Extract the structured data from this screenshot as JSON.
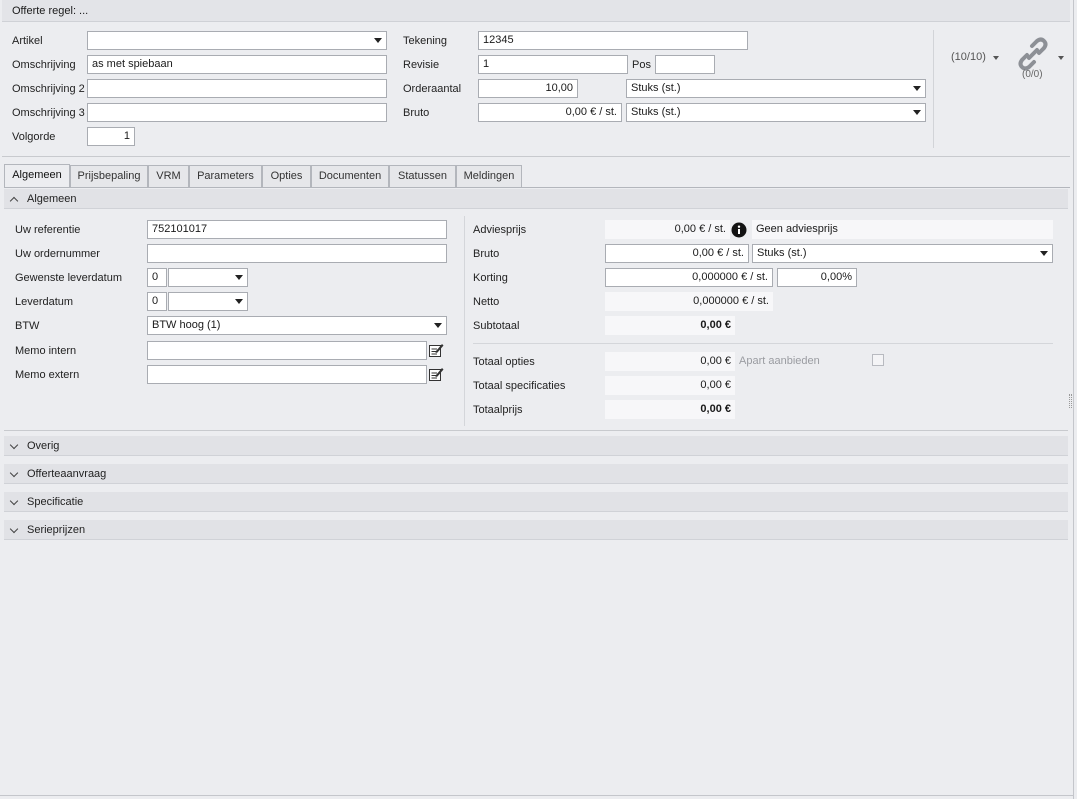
{
  "header": {
    "title": "Offerte regel: ..."
  },
  "top": {
    "artikel_label": "Artikel",
    "artikel_value": "",
    "omschrijving_label": "Omschrijving",
    "omschrijving_value": "as met spiebaan",
    "omschrijving2_label": "Omschrijving 2",
    "omschrijving2_value": "",
    "omschrijving3_label": "Omschrijving 3",
    "omschrijving3_value": "",
    "volgorde_label": "Volgorde",
    "volgorde_value": "1",
    "tekening_label": "Tekening",
    "tekening_value": "12345",
    "revisie_label": "Revisie",
    "revisie_value": "1",
    "pos_label": "Pos",
    "pos_value": "",
    "orderaantal_label": "Orderaantal",
    "orderaantal_value": "10,00",
    "orderaantal_unit": "Stuks (st.)",
    "bruto_label": "Bruto",
    "bruto_value": "0,00 € / st.",
    "bruto_unit": "Stuks (st.)",
    "counter": "(10/10)",
    "link_count": "(0/0)"
  },
  "tabs": [
    {
      "label": "Algemeen"
    },
    {
      "label": "Prijsbepaling"
    },
    {
      "label": "VRM"
    },
    {
      "label": "Parameters"
    },
    {
      "label": "Opties"
    },
    {
      "label": "Documenten"
    },
    {
      "label": "Statussen"
    },
    {
      "label": "Meldingen"
    }
  ],
  "algemeen": {
    "section_title": "Algemeen",
    "uw_referentie_label": "Uw referentie",
    "uw_referentie_value": "752101017",
    "uw_ordernummer_label": "Uw ordernummer",
    "uw_ordernummer_value": "",
    "gewenste_leverdatum_label": "Gewenste leverdatum",
    "gewenste_leverdatum_num": "0",
    "leverdatum_label": "Leverdatum",
    "leverdatum_num": "0",
    "btw_label": "BTW",
    "btw_value": "BTW hoog (1)",
    "memo_intern_label": "Memo intern",
    "memo_extern_label": "Memo extern",
    "adviesprijs_label": "Adviesprijs",
    "adviesprijs_value": "0,00 € / st.",
    "adviesprijs_note": "Geen adviesprijs",
    "bruto_label": "Bruto",
    "bruto_value": "0,00 € / st.",
    "bruto_unit": "Stuks (st.)",
    "korting_label": "Korting",
    "korting_value": "0,000000 € / st.",
    "korting_pct": "0,00%",
    "netto_label": "Netto",
    "netto_value": "0,000000 € / st.",
    "subtotaal_label": "Subtotaal",
    "subtotaal_value": "0,00 €",
    "totaal_opties_label": "Totaal opties",
    "totaal_opties_value": "0,00 €",
    "apart_aanbieden_label": "Apart aanbieden",
    "totaal_spec_label": "Totaal specificaties",
    "totaal_spec_value": "0,00 €",
    "totaalprijs_label": "Totaalprijs",
    "totaalprijs_value": "0,00 €"
  },
  "sections": [
    {
      "label": "Overig"
    },
    {
      "label": "Offerteaanvraag"
    },
    {
      "label": "Specificatie"
    },
    {
      "label": "Serieprijzen"
    }
  ]
}
